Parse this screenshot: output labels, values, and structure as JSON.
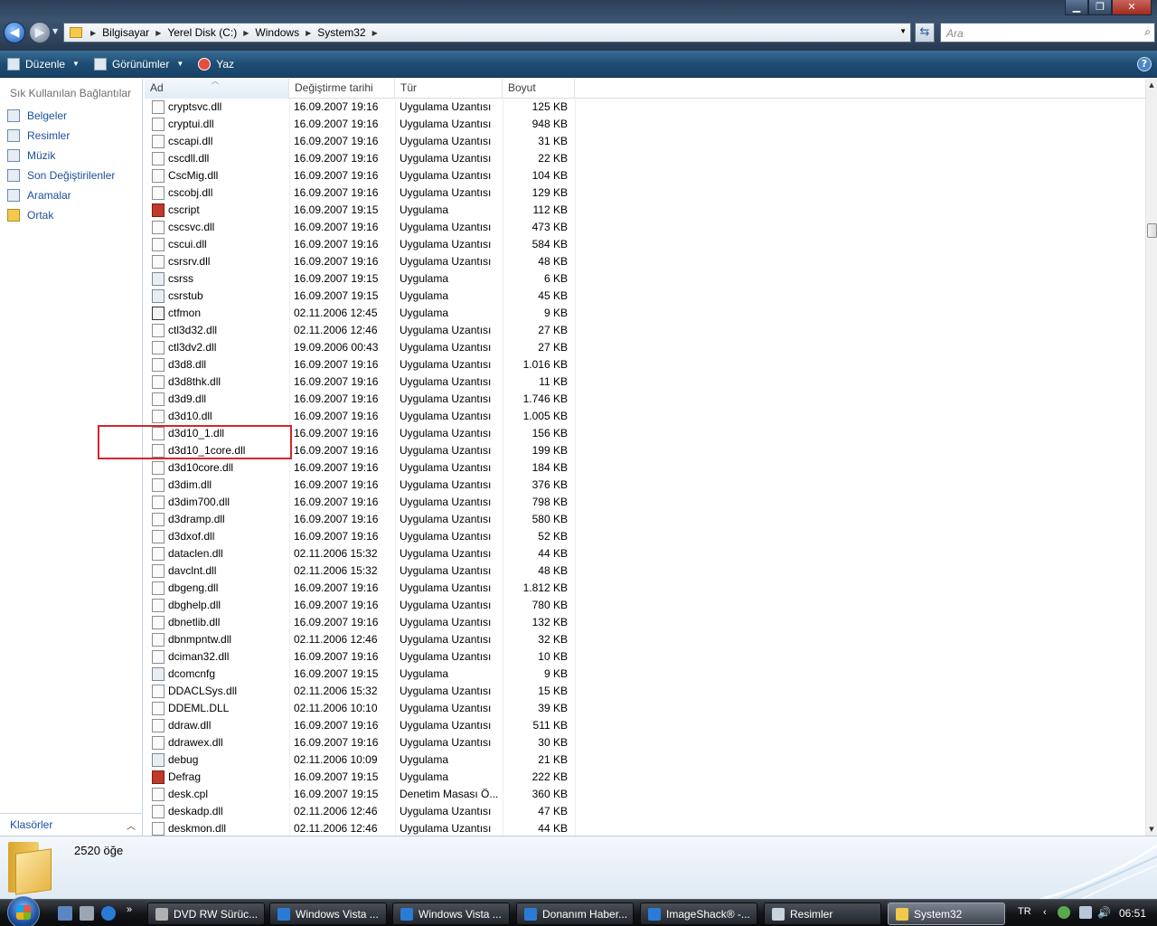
{
  "window": {
    "address": [
      "Bilgisayar",
      "Yerel Disk (C:)",
      "Windows",
      "System32"
    ],
    "search_placeholder": "Ara",
    "minimize": "▁",
    "maximize": "❐",
    "close": "✕"
  },
  "toolbar": {
    "organize": "Düzenle",
    "views": "Görünümler",
    "burn": "Yaz",
    "help": "?"
  },
  "sidebar": {
    "title": "Sık Kullanılan Bağlantılar",
    "items": [
      {
        "label": "Belgeler",
        "icon": "documents-icon"
      },
      {
        "label": "Resimler",
        "icon": "pictures-icon"
      },
      {
        "label": "Müzik",
        "icon": "music-icon"
      },
      {
        "label": "Son Değiştirilenler",
        "icon": "recent-icon"
      },
      {
        "label": "Aramalar",
        "icon": "searches-icon"
      },
      {
        "label": "Ortak",
        "icon": "public-folder-icon"
      }
    ],
    "folders_label": "Klasörler"
  },
  "list": {
    "columns": [
      "Ad",
      "Değiştirme tarihi",
      "Tür",
      "Boyut"
    ],
    "rows": [
      {
        "name": "cryptsvc.dll",
        "date": "16.09.2007 19:16",
        "type": "Uygulama Uzantısı",
        "size": "125 KB",
        "icon": "dll"
      },
      {
        "name": "cryptui.dll",
        "date": "16.09.2007 19:16",
        "type": "Uygulama Uzantısı",
        "size": "948 KB",
        "icon": "dll"
      },
      {
        "name": "cscapi.dll",
        "date": "16.09.2007 19:16",
        "type": "Uygulama Uzantısı",
        "size": "31 KB",
        "icon": "dll"
      },
      {
        "name": "cscdll.dll",
        "date": "16.09.2007 19:16",
        "type": "Uygulama Uzantısı",
        "size": "22 KB",
        "icon": "dll"
      },
      {
        "name": "CscMig.dll",
        "date": "16.09.2007 19:16",
        "type": "Uygulama Uzantısı",
        "size": "104 KB",
        "icon": "dll"
      },
      {
        "name": "cscobj.dll",
        "date": "16.09.2007 19:16",
        "type": "Uygulama Uzantısı",
        "size": "129 KB",
        "icon": "dll"
      },
      {
        "name": "cscript",
        "date": "16.09.2007 19:15",
        "type": "Uygulama",
        "size": "112 KB",
        "icon": "red"
      },
      {
        "name": "cscsvc.dll",
        "date": "16.09.2007 19:16",
        "type": "Uygulama Uzantısı",
        "size": "473 KB",
        "icon": "dll"
      },
      {
        "name": "cscui.dll",
        "date": "16.09.2007 19:16",
        "type": "Uygulama Uzantısı",
        "size": "584 KB",
        "icon": "dll"
      },
      {
        "name": "csrsrv.dll",
        "date": "16.09.2007 19:16",
        "type": "Uygulama Uzantısı",
        "size": "48 KB",
        "icon": "dll"
      },
      {
        "name": "csrss",
        "date": "16.09.2007 19:15",
        "type": "Uygulama",
        "size": "6 KB",
        "icon": "app"
      },
      {
        "name": "csrstub",
        "date": "16.09.2007 19:15",
        "type": "Uygulama",
        "size": "45 KB",
        "icon": "app"
      },
      {
        "name": "ctfmon",
        "date": "02.11.2006 12:45",
        "type": "Uygulama",
        "size": "9 KB",
        "icon": "pen"
      },
      {
        "name": "ctl3d32.dll",
        "date": "02.11.2006 12:46",
        "type": "Uygulama Uzantısı",
        "size": "27 KB",
        "icon": "dll"
      },
      {
        "name": "ctl3dv2.dll",
        "date": "19.09.2006 00:43",
        "type": "Uygulama Uzantısı",
        "size": "27 KB",
        "icon": "dll"
      },
      {
        "name": "d3d8.dll",
        "date": "16.09.2007 19:16",
        "type": "Uygulama Uzantısı",
        "size": "1.016 KB",
        "icon": "dll"
      },
      {
        "name": "d3d8thk.dll",
        "date": "16.09.2007 19:16",
        "type": "Uygulama Uzantısı",
        "size": "11 KB",
        "icon": "dll"
      },
      {
        "name": "d3d9.dll",
        "date": "16.09.2007 19:16",
        "type": "Uygulama Uzantısı",
        "size": "1.746 KB",
        "icon": "dll"
      },
      {
        "name": "d3d10.dll",
        "date": "16.09.2007 19:16",
        "type": "Uygulama Uzantısı",
        "size": "1.005 KB",
        "icon": "dll"
      },
      {
        "name": "d3d10_1.dll",
        "date": "16.09.2007 19:16",
        "type": "Uygulama Uzantısı",
        "size": "156 KB",
        "icon": "dll"
      },
      {
        "name": "d3d10_1core.dll",
        "date": "16.09.2007 19:16",
        "type": "Uygulama Uzantısı",
        "size": "199 KB",
        "icon": "dll"
      },
      {
        "name": "d3d10core.dll",
        "date": "16.09.2007 19:16",
        "type": "Uygulama Uzantısı",
        "size": "184 KB",
        "icon": "dll"
      },
      {
        "name": "d3dim.dll",
        "date": "16.09.2007 19:16",
        "type": "Uygulama Uzantısı",
        "size": "376 KB",
        "icon": "dll"
      },
      {
        "name": "d3dim700.dll",
        "date": "16.09.2007 19:16",
        "type": "Uygulama Uzantısı",
        "size": "798 KB",
        "icon": "dll"
      },
      {
        "name": "d3dramp.dll",
        "date": "16.09.2007 19:16",
        "type": "Uygulama Uzantısı",
        "size": "580 KB",
        "icon": "dll"
      },
      {
        "name": "d3dxof.dll",
        "date": "16.09.2007 19:16",
        "type": "Uygulama Uzantısı",
        "size": "52 KB",
        "icon": "dll"
      },
      {
        "name": "dataclen.dll",
        "date": "02.11.2006 15:32",
        "type": "Uygulama Uzantısı",
        "size": "44 KB",
        "icon": "dll"
      },
      {
        "name": "davclnt.dll",
        "date": "02.11.2006 15:32",
        "type": "Uygulama Uzantısı",
        "size": "48 KB",
        "icon": "dll"
      },
      {
        "name": "dbgeng.dll",
        "date": "16.09.2007 19:16",
        "type": "Uygulama Uzantısı",
        "size": "1.812 KB",
        "icon": "dll"
      },
      {
        "name": "dbghelp.dll",
        "date": "16.09.2007 19:16",
        "type": "Uygulama Uzantısı",
        "size": "780 KB",
        "icon": "dll"
      },
      {
        "name": "dbnetlib.dll",
        "date": "16.09.2007 19:16",
        "type": "Uygulama Uzantısı",
        "size": "132 KB",
        "icon": "dll"
      },
      {
        "name": "dbnmpntw.dll",
        "date": "02.11.2006 12:46",
        "type": "Uygulama Uzantısı",
        "size": "32 KB",
        "icon": "dll"
      },
      {
        "name": "dciman32.dll",
        "date": "16.09.2007 19:16",
        "type": "Uygulama Uzantısı",
        "size": "10 KB",
        "icon": "dll"
      },
      {
        "name": "dcomcnfg",
        "date": "16.09.2007 19:15",
        "type": "Uygulama",
        "size": "9 KB",
        "icon": "app"
      },
      {
        "name": "DDACLSys.dll",
        "date": "02.11.2006 15:32",
        "type": "Uygulama Uzantısı",
        "size": "15 KB",
        "icon": "dll"
      },
      {
        "name": "DDEML.DLL",
        "date": "02.11.2006 10:10",
        "type": "Uygulama Uzantısı",
        "size": "39 KB",
        "icon": "dll"
      },
      {
        "name": "ddraw.dll",
        "date": "16.09.2007 19:16",
        "type": "Uygulama Uzantısı",
        "size": "511 KB",
        "icon": "dll"
      },
      {
        "name": "ddrawex.dll",
        "date": "16.09.2007 19:16",
        "type": "Uygulama Uzantısı",
        "size": "30 KB",
        "icon": "dll"
      },
      {
        "name": "debug",
        "date": "02.11.2006 10:09",
        "type": "Uygulama",
        "size": "21 KB",
        "icon": "app"
      },
      {
        "name": "Defrag",
        "date": "16.09.2007 19:15",
        "type": "Uygulama",
        "size": "222 KB",
        "icon": "red"
      },
      {
        "name": "desk.cpl",
        "date": "16.09.2007 19:15",
        "type": "Denetim Masası Ö...",
        "size": "360 KB",
        "icon": "dll"
      },
      {
        "name": "deskadp.dll",
        "date": "02.11.2006 12:46",
        "type": "Uygulama Uzantısı",
        "size": "47 KB",
        "icon": "dll"
      },
      {
        "name": "deskmon.dll",
        "date": "02.11.2006 12:46",
        "type": "Uygulama Uzantısı",
        "size": "44 KB",
        "icon": "dll"
      }
    ]
  },
  "status": {
    "item_count": "2520 öğe"
  },
  "taskbar": {
    "tasks": [
      {
        "label": "DVD RW Sürüc...",
        "color": "#b0b0b0"
      },
      {
        "label": "Windows Vista ...",
        "color": "#2b7bd6"
      },
      {
        "label": "Windows Vista ...",
        "color": "#2b7bd6"
      },
      {
        "label": "Donanım Haber...",
        "color": "#2b7bd6"
      },
      {
        "label": "ImageShack® -...",
        "color": "#2b7bd6"
      },
      {
        "label": "Resimler",
        "color": "#c9d3de"
      },
      {
        "label": "System32",
        "color": "#f2c94c"
      }
    ],
    "lang": "TR",
    "clock": "06:51"
  }
}
